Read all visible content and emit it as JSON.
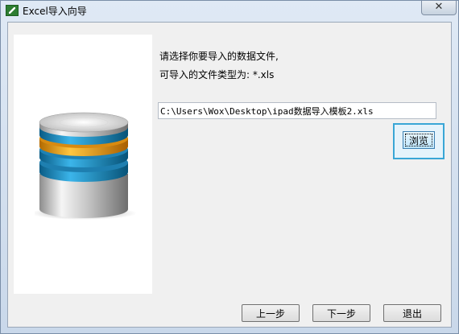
{
  "window": {
    "title": "Excel导入向导",
    "close_label": "✕"
  },
  "prompt": {
    "line1": "请选择你要导入的数据文件,",
    "line2": "可导入的文件类型为: *.xls"
  },
  "file_path": {
    "value": "C:\\Users\\Wox\\Desktop\\ipad数据导入模板2.xls",
    "placeholder": ""
  },
  "buttons": {
    "browse": "浏览",
    "prev": "上一步",
    "next": "下一步",
    "exit": "退出"
  },
  "icons": {
    "app": "excel-icon",
    "side": "database-icon"
  },
  "colors": {
    "db_orange": "#f0a020",
    "db_blue": "#1a8fc4",
    "focus_border": "#39a6d6"
  }
}
